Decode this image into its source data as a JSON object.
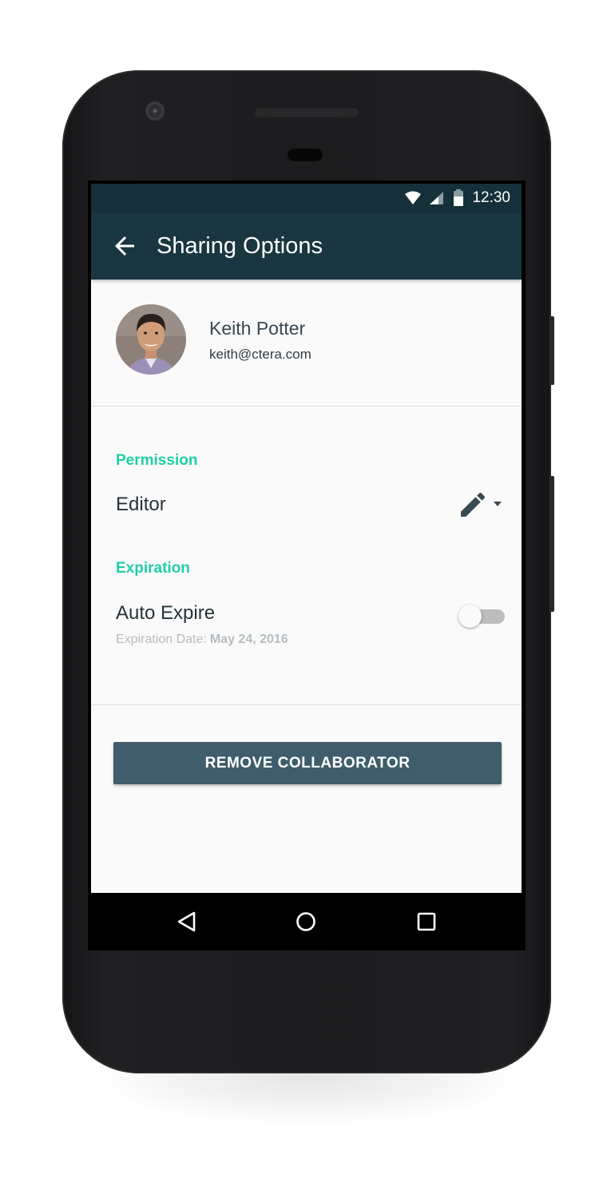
{
  "status_bar": {
    "time": "12:30",
    "icons": [
      "wifi-icon",
      "cell-signal-icon",
      "battery-icon"
    ]
  },
  "app_bar": {
    "title": "Sharing Options",
    "back_icon": "arrow-back-icon"
  },
  "profile": {
    "name": "Keith Potter",
    "email": "keith@ctera.com"
  },
  "permission": {
    "label": "Permission",
    "value": "Editor",
    "icon": "pencil-icon"
  },
  "expiration": {
    "label": "Expiration",
    "toggle_label": "Auto Expire",
    "toggle_on": false,
    "date_label": "Expiration Date:",
    "date_value": "May 24, 2016"
  },
  "actions": {
    "remove_label": "REMOVE COLLABORATOR"
  },
  "nav": {
    "icons": [
      "back-triangle-icon",
      "home-circle-icon",
      "recents-square-icon"
    ]
  },
  "colors": {
    "app_bar": "#1a3641",
    "status_bar": "#153039",
    "accent": "#1fcfa5",
    "button": "#3f5d6b"
  }
}
